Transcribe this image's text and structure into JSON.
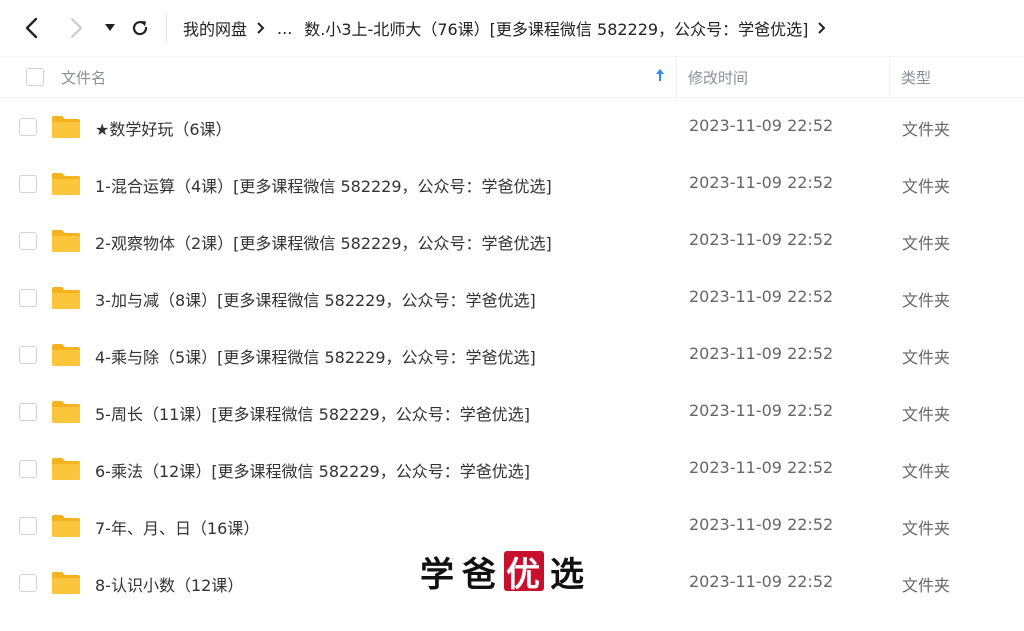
{
  "nav": {
    "back_icon": "chevron-left-icon",
    "forward_icon": "chevron-right-icon",
    "dropdown_icon": "caret-down-icon",
    "refresh_icon": "refresh-icon"
  },
  "breadcrumb": {
    "root": "我的网盘",
    "ellipsis": "...",
    "current": "数.小3上-北师大（76课）[更多课程微信 582229，公众号：学爸优选]"
  },
  "table": {
    "headers": {
      "name": "文件名",
      "modified": "修改时间",
      "type": "类型"
    },
    "sort_icon": "arrow-up-icon",
    "rows": [
      {
        "name": "★数学好玩（6课）",
        "modified": "2023-11-09 22:52",
        "type": "文件夹"
      },
      {
        "name": "1-混合运算（4课）[更多课程微信 582229，公众号：学爸优选]",
        "modified": "2023-11-09 22:52",
        "type": "文件夹"
      },
      {
        "name": "2-观察物体（2课）[更多课程微信 582229，公众号：学爸优选]",
        "modified": "2023-11-09 22:52",
        "type": "文件夹"
      },
      {
        "name": "3-加与减（8课）[更多课程微信 582229，公众号：学爸优选]",
        "modified": "2023-11-09 22:52",
        "type": "文件夹"
      },
      {
        "name": "4-乘与除（5课）[更多课程微信 582229，公众号：学爸优选]",
        "modified": "2023-11-09 22:52",
        "type": "文件夹"
      },
      {
        "name": "5-周长（11课）[更多课程微信 582229，公众号：学爸优选]",
        "modified": "2023-11-09 22:52",
        "type": "文件夹"
      },
      {
        "name": "6-乘法（12课）[更多课程微信 582229，公众号：学爸优选]",
        "modified": "2023-11-09 22:52",
        "type": "文件夹"
      },
      {
        "name": "7-年、月、日（16课）",
        "modified": "2023-11-09 22:52",
        "type": "文件夹"
      },
      {
        "name": "8-认识小数（12课）",
        "modified": "2023-11-09 22:52",
        "type": "文件夹"
      }
    ]
  },
  "watermark": {
    "c1": "学",
    "c2": "爸",
    "c3": "优",
    "c4": "选"
  },
  "colors": {
    "folder": "#fbc53c",
    "folder_dark": "#f5b21f",
    "accent": "#2a8cf0",
    "stamp": "#c8102e"
  }
}
